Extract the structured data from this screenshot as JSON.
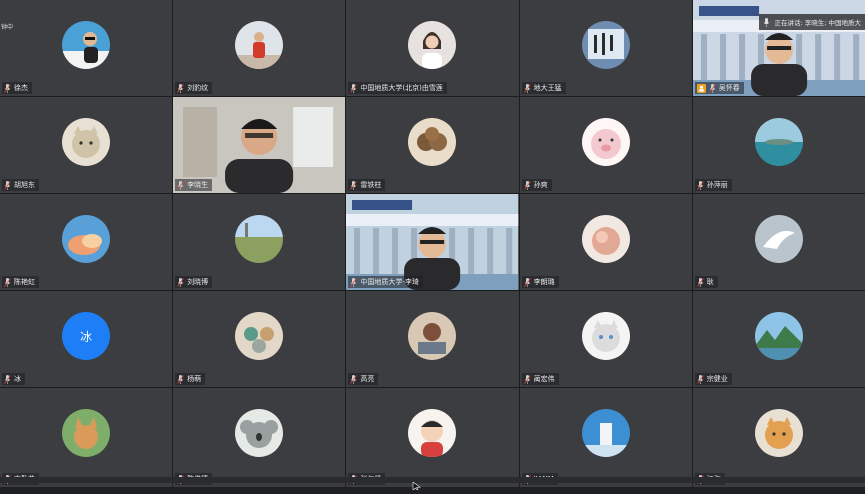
{
  "speaking": {
    "label": "正在讲话: 李晓生; 中国地质大"
  },
  "corner_label": "钟中",
  "tiles": [
    {
      "name": "徐杰",
      "avatar": "photo-man-sunglasses",
      "bg": "#4aa1d6"
    },
    {
      "name": "刘豹纹",
      "avatar": "photo-person-red",
      "bg": "#c9b9a8"
    },
    {
      "name": "中国地质大学(北京)由雪莲",
      "avatar": "photo-woman",
      "bg": "#e7e2df"
    },
    {
      "name": "地大王猛",
      "avatar": "photo-calligraphy",
      "bg": "#6f8db0"
    },
    {
      "name": "吴怀春",
      "avatar": "video-man-glasses",
      "bg": "#cbd7e4",
      "host": true
    },
    {
      "name": "胡旭东",
      "avatar": "photo-cat",
      "bg": "#cfc3a8"
    },
    {
      "name": "李晓生",
      "avatar": "video-man-speaker",
      "bg": "#c9c6c0"
    },
    {
      "name": "雷铁柱",
      "avatar": "photo-bread",
      "bg": "#7b5a3a"
    },
    {
      "name": "孙爽",
      "avatar": "photo-cartoon-pig",
      "bg": "#f3c9cf"
    },
    {
      "name": "孙萍丽",
      "avatar": "photo-sea",
      "bg": "#2f8fa0"
    },
    {
      "name": "陈艳虹",
      "avatar": "photo-cloud",
      "bg": "#f0a070"
    },
    {
      "name": "刘晓博",
      "avatar": "photo-field",
      "bg": "#8ca060"
    },
    {
      "name": "中国地质大学-李琦",
      "avatar": "video-man-campus",
      "bg": "#c0d1e0"
    },
    {
      "name": "李朗璐",
      "avatar": "photo-peach",
      "bg": "#e2a896"
    },
    {
      "name": "耿",
      "avatar": "photo-bird",
      "bg": "#b9c4cc"
    },
    {
      "name": "冰",
      "avatar": "text-avatar",
      "avatar_text": "冰",
      "bg": "#1e7ef5"
    },
    {
      "name": "杨萌",
      "avatar": "photo-tea",
      "bg": "#9aa6a0"
    },
    {
      "name": "高亮",
      "avatar": "photo-reading",
      "bg": "#7b4f3a"
    },
    {
      "name": "蔺宏伟",
      "avatar": "photo-white-cat",
      "bg": "#dcdcdc"
    },
    {
      "name": "宗健业",
      "avatar": "photo-landscape",
      "bg": "#4f8fb0"
    },
    {
      "name": "文勤艾",
      "avatar": "photo-fox",
      "bg": "#d99a5a"
    },
    {
      "name": "陈俊德",
      "avatar": "photo-koala",
      "bg": "#9aa0a0"
    },
    {
      "name": "张仁贤",
      "avatar": "photo-child",
      "bg": "#f2d2b8"
    },
    {
      "name": "JIANM",
      "avatar": "photo-building",
      "bg": "#3c8fd2"
    },
    {
      "name": "江海",
      "avatar": "photo-kitten",
      "bg": "#e2a050"
    }
  ]
}
